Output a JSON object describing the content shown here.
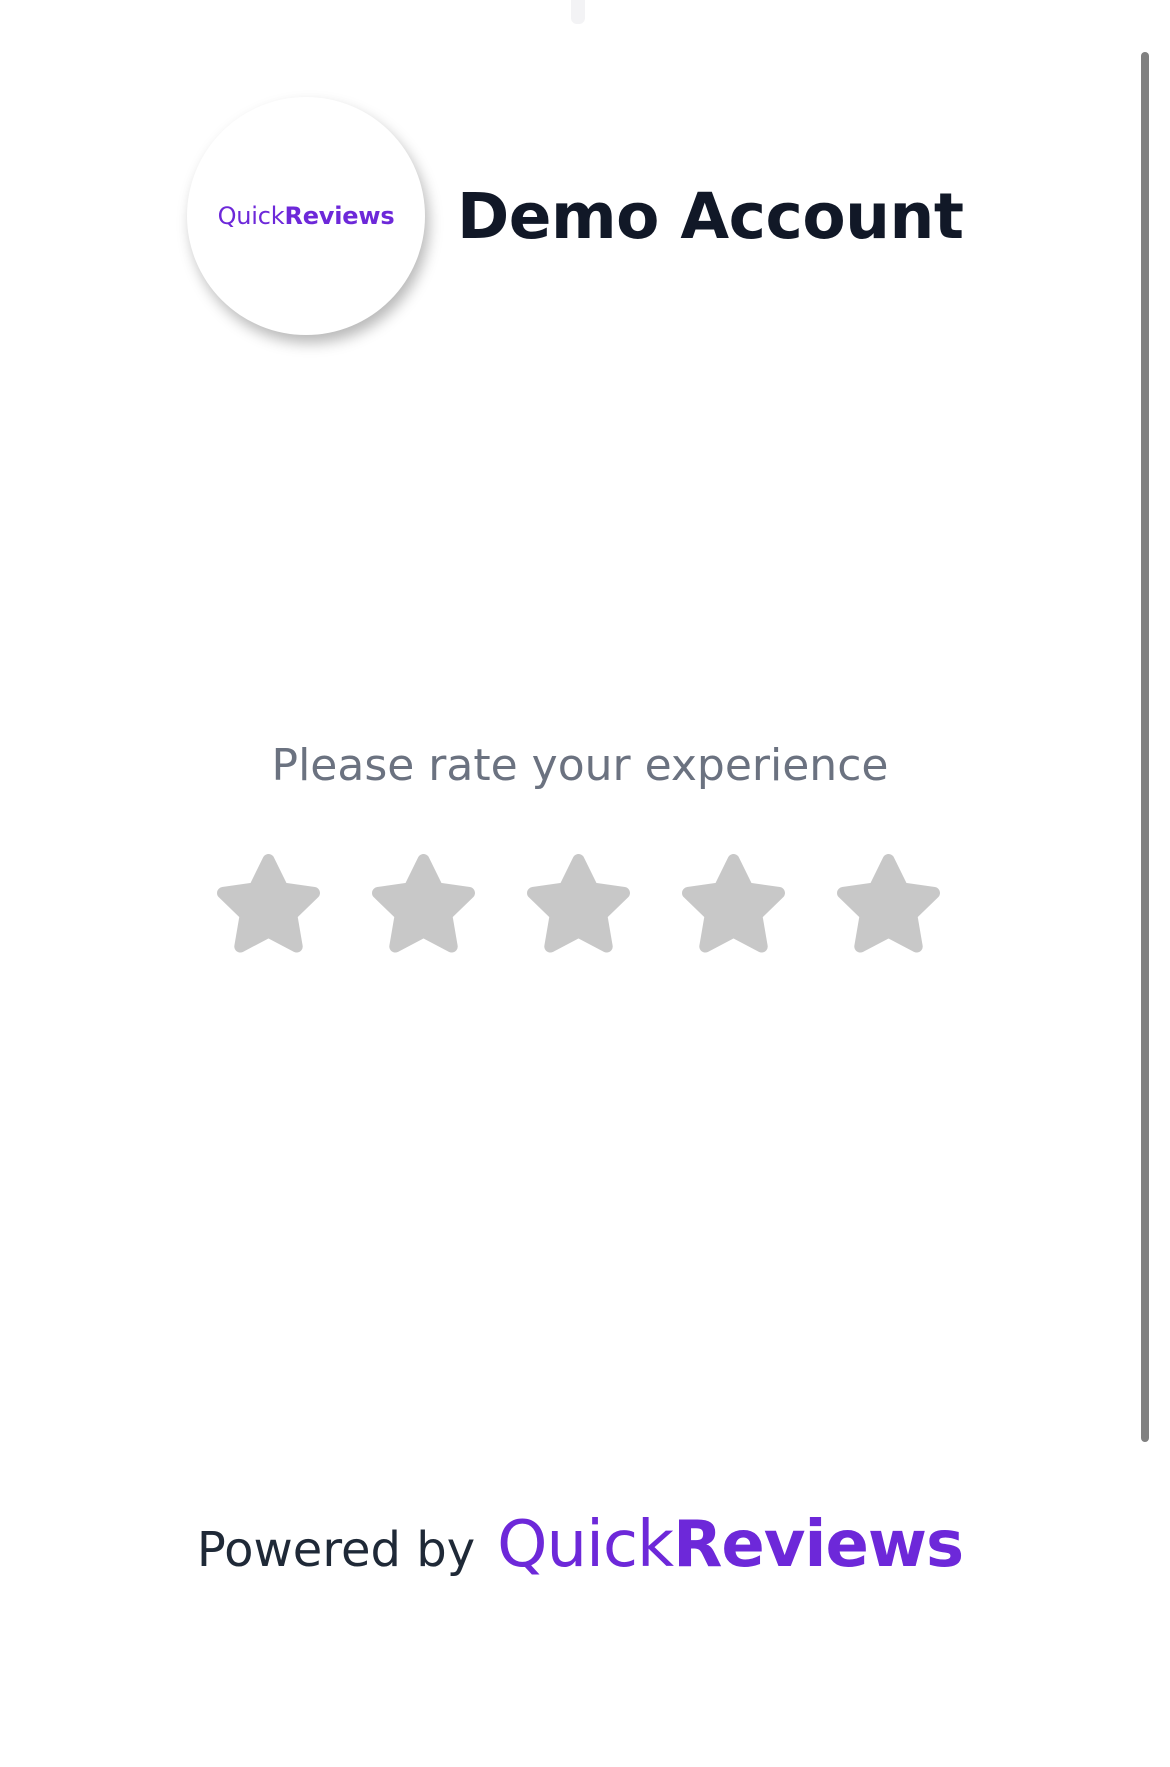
{
  "header": {
    "logo": {
      "text_light": "Quick",
      "text_bold": "Reviews"
    },
    "account_name": "Demo Account"
  },
  "rating": {
    "prompt": "Please rate your experience",
    "max_stars": 5,
    "selected": 0,
    "star_color": "#c8c8c8"
  },
  "footer": {
    "powered_by": "Powered by",
    "brand_light": "Quick",
    "brand_bold": "Reviews"
  },
  "colors": {
    "brand": "#6d28d9",
    "heading": "#111827",
    "muted_text": "#6b7280"
  }
}
